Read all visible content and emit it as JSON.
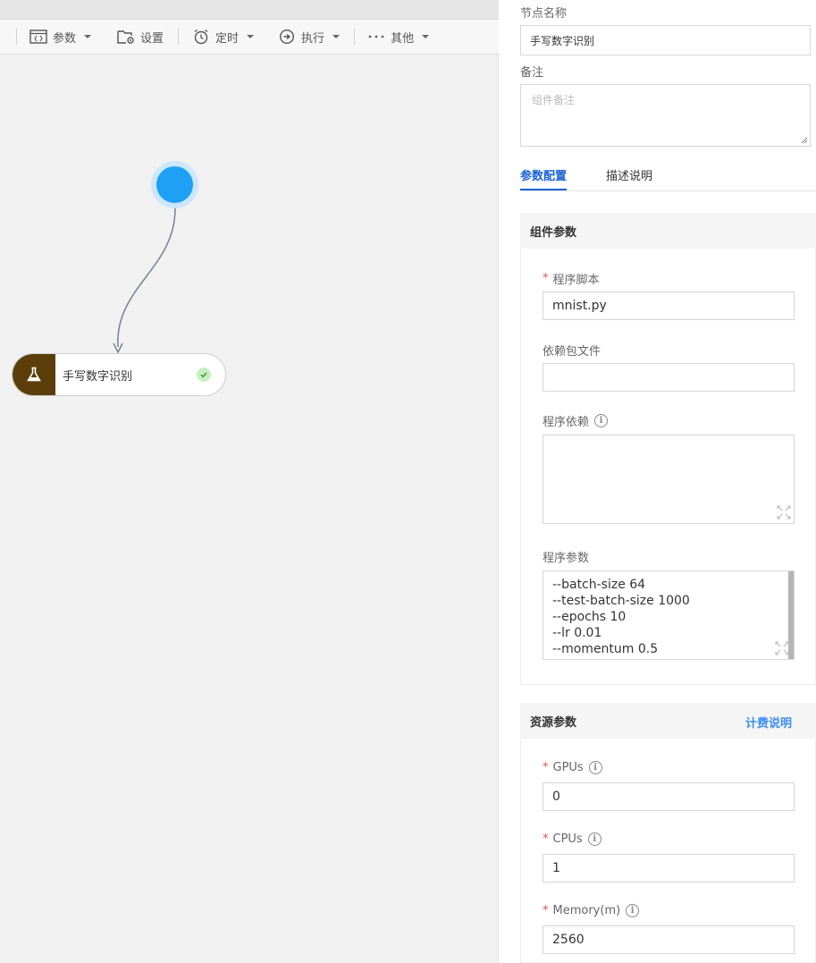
{
  "toolbar": {
    "items": [
      {
        "label": "参数",
        "icon": "code-window-icon",
        "dropdown": true
      },
      {
        "label": "设置",
        "icon": "settings-folder-icon",
        "dropdown": false
      },
      {
        "label": "定时",
        "icon": "alarm-clock-icon",
        "dropdown": true
      },
      {
        "label": "执行",
        "icon": "run-circle-icon",
        "dropdown": true
      },
      {
        "label": "其他",
        "icon": "more-dots-icon",
        "dropdown": true
      }
    ]
  },
  "canvas": {
    "node": {
      "label": "手写数字识别",
      "icon": "flask-icon",
      "status": "success"
    }
  },
  "panel": {
    "node_name_label": "节点名称",
    "node_name_value": "手写数字识别",
    "remark_label": "备注",
    "remark_placeholder": "组件备注",
    "tabs": [
      {
        "label": "参数配置",
        "active": true
      },
      {
        "label": "描述说明",
        "active": false
      }
    ],
    "component_params": {
      "title": "组件参数",
      "script_label": "程序脚本",
      "script_value": "mnist.py",
      "deps_file_label": "依赖包文件",
      "deps_file_value": "",
      "deps_label": "程序依赖",
      "args_label": "程序参数",
      "args_lines": [
        "--batch-size 64",
        "--test-batch-size 1000",
        "--epochs 10",
        "--lr 0.01",
        "--momentum 0.5"
      ]
    },
    "resource_params": {
      "title": "资源参数",
      "billing_link": "计费说明",
      "gpus_label": "GPUs",
      "gpus_value": "0",
      "cpus_label": "CPUs",
      "cpus_value": "1",
      "memory_label": "Memory(m)",
      "memory_value": "2560"
    }
  }
}
